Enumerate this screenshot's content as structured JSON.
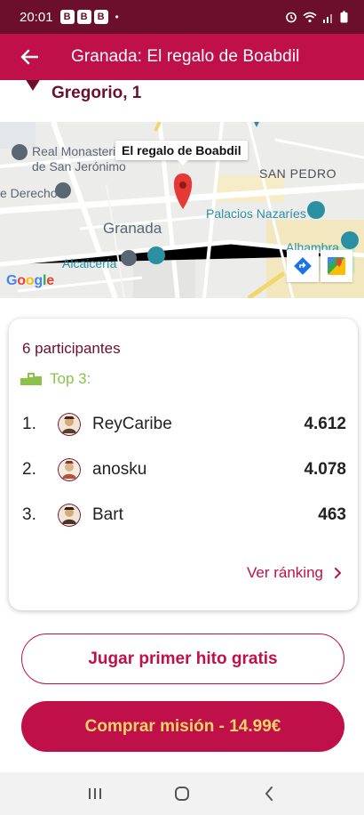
{
  "status_bar": {
    "time": "20:01",
    "badges": [
      "B",
      "B",
      "B"
    ],
    "dot": "•"
  },
  "app_bar": {
    "title": "Granada: El regalo de Boabdil"
  },
  "location": {
    "text": "Gregorio, 1"
  },
  "map": {
    "callout": "El regalo de Boabdil",
    "labels": {
      "real_monasterio_1": "Real Monasterio",
      "real_monasterio_2": "de San Jerónimo",
      "derecho": "e Derecho",
      "san_pedro": "SAN PEDRO",
      "palacios": "Palacios Nazaríes",
      "granada": "Granada",
      "alcaiceria": "Alcaicería",
      "alhambra": "Alhambra"
    },
    "google": "Google"
  },
  "card": {
    "participants": "6 participantes",
    "top3": "Top 3:",
    "rankings": [
      {
        "num": "1.",
        "name": "ReyCaribe",
        "score": "4.612"
      },
      {
        "num": "2.",
        "name": "anosku",
        "score": "4.078"
      },
      {
        "num": "3.",
        "name": "Bart",
        "score": "463"
      }
    ],
    "ranking_link": "Ver ránking"
  },
  "buttons": {
    "free": "Jugar primer hito gratis",
    "buy": "Comprar misión - 14.99€"
  },
  "colors": {
    "primary": "#c0104a",
    "dark": "#6b0f2c",
    "accent": "#f3d468",
    "green": "#8bc34a"
  }
}
